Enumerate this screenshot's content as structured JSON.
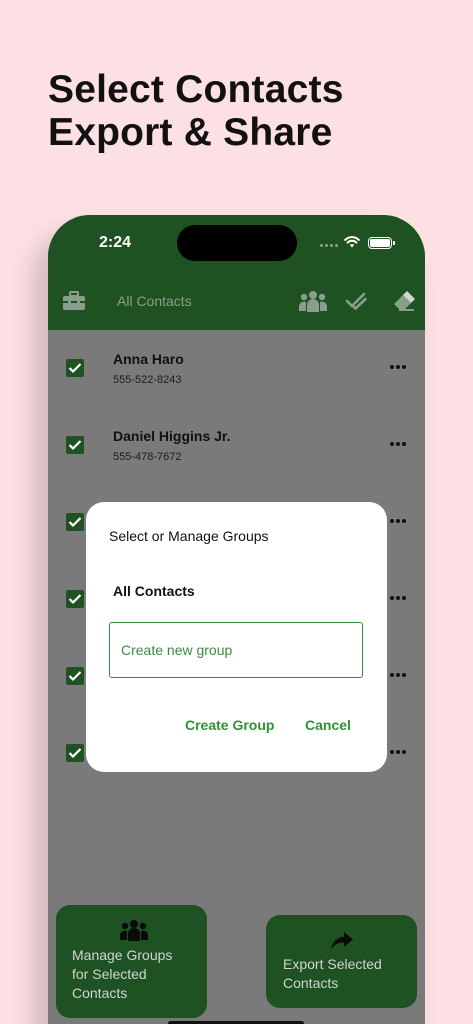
{
  "headline": {
    "line1": "Select Contacts",
    "line2": "Export & Share"
  },
  "status_bar": {
    "time": "2:24"
  },
  "app_bar": {
    "title": "All Contacts",
    "icons": [
      "toolbox-icon",
      "groups-icon",
      "double-check-icon",
      "eraser-icon"
    ]
  },
  "contacts": [
    {
      "name": "Anna Haro",
      "phone": "555-522-8243"
    },
    {
      "name": "Daniel Higgins Jr.",
      "phone": "555-478-7672"
    }
  ],
  "dialog": {
    "title": "Select or Manage Groups",
    "group_item": "All Contacts",
    "input_placeholder": "Create new group",
    "input_value": "",
    "create_label": "Create Group",
    "cancel_label": "Cancel"
  },
  "actions": {
    "manage_groups_line1": "Manage Groups",
    "manage_groups_line2": "for Selected",
    "manage_groups_line3": "Contacts",
    "export_line1": "Export Selected",
    "export_line2": "Contacts"
  },
  "colors": {
    "background": "#fde0e3",
    "app_bar": "#1f5222",
    "accent_green": "#2f9236",
    "overlay_gray": "#7a7a7a"
  }
}
